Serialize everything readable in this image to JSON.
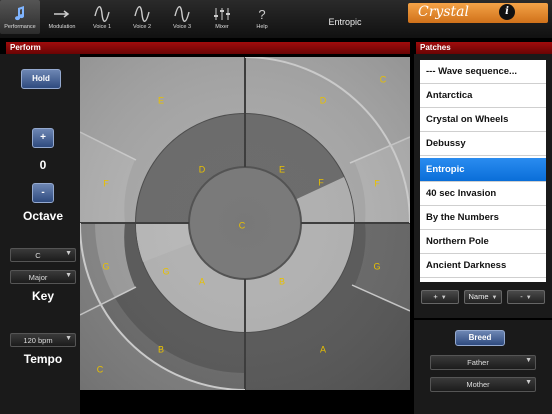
{
  "toolbar": {
    "tabs": [
      {
        "label": "Performance",
        "icon": "music-note-icon"
      },
      {
        "label": "Modulation",
        "icon": "arrow-right-icon"
      },
      {
        "label": "Voice 1",
        "icon": "sine-wave-icon"
      },
      {
        "label": "Voice 2",
        "icon": "sine-wave-icon"
      },
      {
        "label": "Voice 3",
        "icon": "sine-wave-icon"
      },
      {
        "label": "Mixer",
        "icon": "sliders-icon"
      },
      {
        "label": "Help",
        "icon": "question-icon"
      }
    ],
    "active_tab": "Performance",
    "patch_title": "Entropic",
    "logo_text": "Crystal",
    "info_label": "i"
  },
  "perform": {
    "header": "Perform",
    "hold_label": "Hold",
    "plus_label": "+",
    "octave_value": "0",
    "minus_label": "-",
    "octave_label": "Octave",
    "key_note": "C",
    "key_scale": "Major",
    "key_label": "Key",
    "tempo_value": "120 bpm",
    "tempo_label": "Tempo",
    "pad_labels": {
      "outer": [
        "E",
        "D",
        "C",
        "F",
        "F",
        "G",
        "G",
        "C",
        "B",
        "A"
      ],
      "middle": [
        "D",
        "E",
        "F",
        "G",
        "A",
        "B"
      ],
      "center": "C"
    }
  },
  "patches": {
    "header": "Patches",
    "items": [
      "--- Wave sequence...",
      "Antarctica",
      "Crystal on Wheels",
      "Debussy",
      "Entropic",
      "40 sec Invasion",
      "By the Numbers",
      "Northern Pole",
      "Ancient Darkness"
    ],
    "selected": "Entropic",
    "add_label": "+",
    "name_label": "Name",
    "remove_label": "-"
  },
  "breed": {
    "breed_label": "Breed",
    "father_label": "Father",
    "mother_label": "Mother"
  },
  "colors": {
    "header_red": "#a10c0c",
    "selection_blue": "#0a6ed8",
    "note_yellow": "#e8c000",
    "logo_orange": "#e68a2e"
  }
}
